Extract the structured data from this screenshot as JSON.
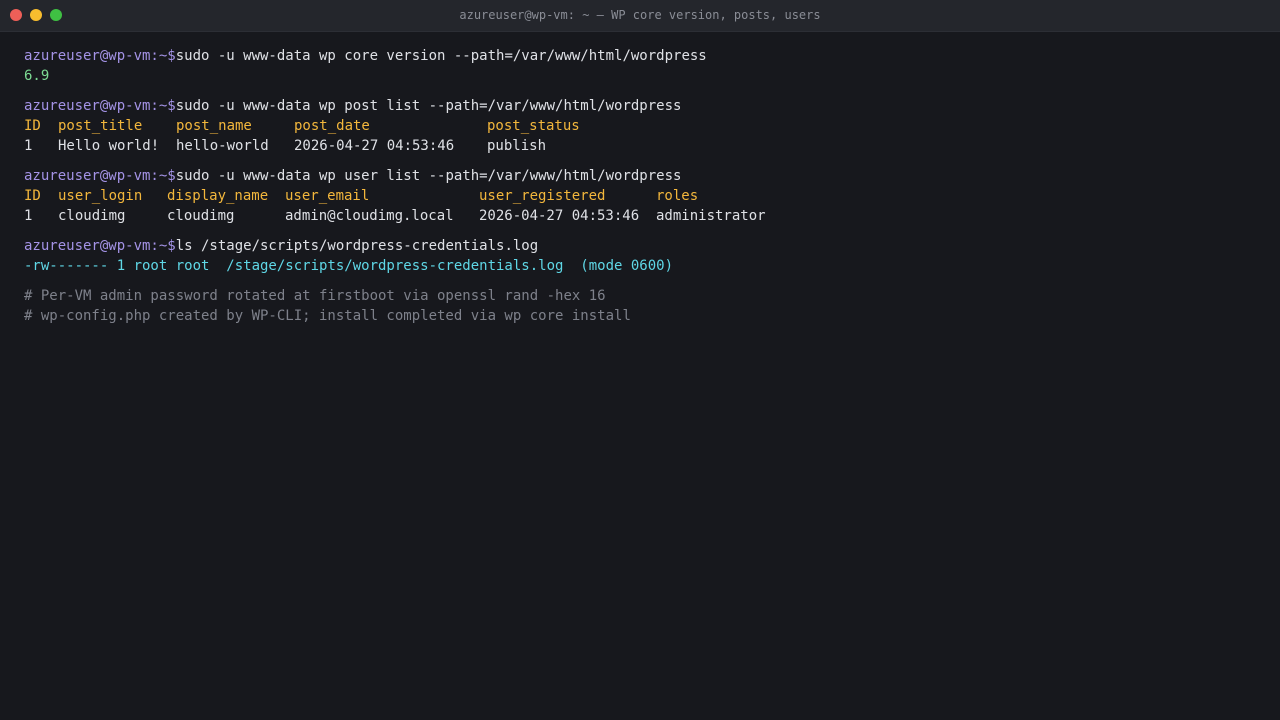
{
  "window": {
    "title": "azureuser@wp-vm: ~ — WP core version, posts, users"
  },
  "prompt": "azureuser@wp-vm:~$",
  "blocks": {
    "version": {
      "command": "sudo -u www-data wp core version --path=/var/www/html/wordpress",
      "output": "6.9"
    },
    "posts": {
      "command": "sudo -u www-data wp post list --path=/var/www/html/wordpress",
      "headers": [
        "ID",
        "post_title",
        "post_name",
        "post_date",
        "post_status"
      ],
      "rows": [
        [
          "1",
          "Hello world!",
          "hello-world",
          "2026-04-27 04:53:46",
          "publish"
        ]
      ]
    },
    "users": {
      "command": "sudo -u www-data wp user list --path=/var/www/html/wordpress",
      "headers": [
        "ID",
        "user_login",
        "display_name",
        "user_email",
        "user_registered",
        "roles"
      ],
      "rows": [
        [
          "1",
          "cloudimg",
          "cloudimg",
          "admin@cloudimg.local",
          "2026-04-27 04:53:46",
          "administrator"
        ]
      ]
    },
    "ls": {
      "command": "ls /stage/scripts/wordpress-credentials.log",
      "output": "-rw------- 1 root root  /stage/scripts/wordpress-credentials.log  (mode 0600)"
    }
  },
  "comments": [
    "# Per-VM admin password rotated at firstboot via openssl rand -hex 16",
    "# wp-config.php created by WP-CLI; install completed via wp core install"
  ]
}
